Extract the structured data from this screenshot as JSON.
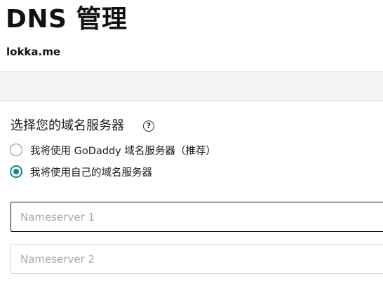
{
  "header": {
    "title": "DNS 管理",
    "domain": "lokka.me"
  },
  "nameservers": {
    "heading": "选择您的域名服务器",
    "help_icon": "question-circle-icon",
    "options": [
      {
        "label": "我将使用 GoDaddy 域名服务器（推荐）",
        "selected": false
      },
      {
        "label": "我将使用自己的域名服务器",
        "selected": true
      }
    ],
    "inputs": [
      {
        "placeholder": "Nameserver 1",
        "value": ""
      },
      {
        "placeholder": "Nameserver 2",
        "value": ""
      }
    ]
  },
  "colors": {
    "accent": "#0c8a8a",
    "band": "#f4f5f6"
  }
}
